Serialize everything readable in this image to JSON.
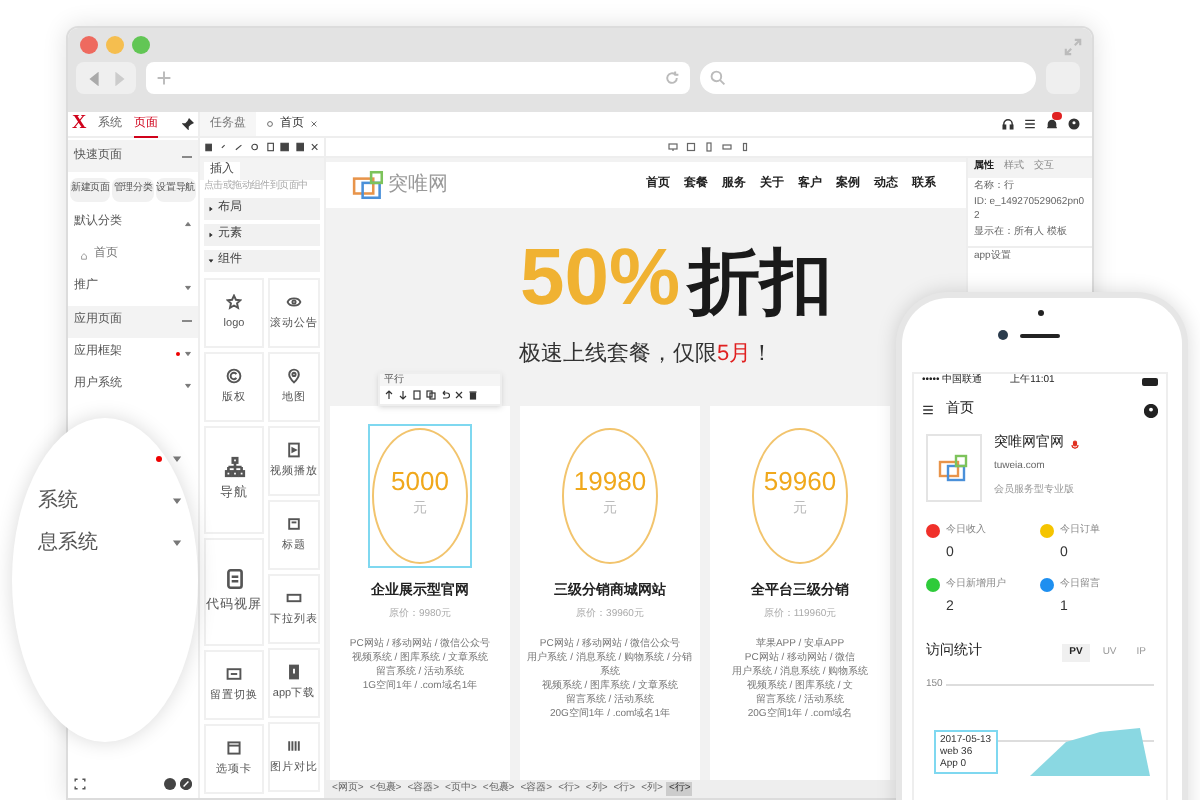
{
  "app_bar": {
    "logo": "X",
    "sidebar_tabs": [
      {
        "label": "系统",
        "selected": false
      },
      {
        "label": "页面",
        "selected": true
      }
    ],
    "doc_tabs": [
      {
        "label": "任务盘",
        "selected": false
      },
      {
        "label": "首页",
        "selected": true
      }
    ]
  },
  "sidebar": [
    {
      "kind": "section",
      "label": "快速页面"
    },
    {
      "kind": "buttons",
      "labels": [
        "新建页面",
        "管理分类",
        "设置导航"
      ]
    },
    {
      "kind": "group",
      "label": "默认分类",
      "expanded": true,
      "dot": false
    },
    {
      "kind": "page",
      "label": "首页"
    },
    {
      "kind": "group",
      "label": "推广",
      "expanded": false,
      "dot": false
    },
    {
      "kind": "section",
      "label": "应用页面"
    },
    {
      "kind": "group",
      "label": "应用框架",
      "expanded": false,
      "dot": true
    },
    {
      "kind": "group",
      "label": "用户系统",
      "expanded": false,
      "dot": false
    }
  ],
  "magnifier": {
    "items": [
      {
        "kind": "dot"
      },
      {
        "kind": "group",
        "label": "系统"
      },
      {
        "kind": "group",
        "label": "息系统"
      }
    ]
  },
  "components_panel": {
    "tab": "插入",
    "hint": "点击或拖动组件到页面中",
    "sections": [
      {
        "label": "布局",
        "expanded": false
      },
      {
        "label": "元素",
        "expanded": false
      },
      {
        "label": "组件",
        "expanded": true
      }
    ],
    "left": [
      {
        "kind": "small",
        "label": "logo"
      },
      {
        "kind": "small",
        "label": "版权"
      },
      {
        "kind": "large",
        "label": "导航"
      },
      {
        "kind": "large",
        "label": "代码视屏"
      },
      {
        "kind": "small",
        "label": "留置切换"
      },
      {
        "kind": "small",
        "label": "选项卡"
      }
    ],
    "right": [
      {
        "label": "滚动公告"
      },
      {
        "label": "地图"
      },
      {
        "label": "视频播放"
      },
      {
        "label": "标题"
      },
      {
        "label": "下拉列表"
      },
      {
        "label": "app下载"
      },
      {
        "label": "图片对比"
      }
    ]
  },
  "site_header": {
    "logo": "突唯网",
    "nav": [
      "首页",
      "套餐",
      "服务",
      "关于",
      "客户",
      "案例",
      "动态",
      "联系"
    ]
  },
  "hero": {
    "highlight": "50%",
    "title": "折扣",
    "subtitle_before": "极速上线套餐，仅限",
    "subtitle_accent": "5月",
    "subtitle_after": "！"
  },
  "selection_toolbar": {
    "label": "平行"
  },
  "plans": [
    {
      "price": "5000",
      "unit": "元",
      "name": "企业展示型官网",
      "original": "原价：9980元",
      "selected": true,
      "features": [
        "PC网站 / 移动网站 / 微信公众号",
        "视频系统 / 图库系统 / 文章系统",
        "留言系统 / 活动系统",
        "1G空间1年 / .com域名1年"
      ]
    },
    {
      "price": "19980",
      "unit": "元",
      "name": "三级分销商城网站",
      "original": "原价：39960元",
      "selected": false,
      "features": [
        "PC网站 / 移动网站 / 微信公众号",
        "用户系统 / 消息系统 / 购物系统 / 分销系统",
        "视频系统 / 图库系统 / 文章系统",
        "留言系统 / 活动系统",
        "20G空间1年 / .com域名1年"
      ]
    },
    {
      "price": "59960",
      "unit": "元",
      "name": "全平台三级分销",
      "original": "原价：119960元",
      "selected": false,
      "features": [
        "苹果APP / 安卓APP",
        "PC网站 / 移动网站 / 微信",
        "用户系统 / 消息系统 / 购物系统",
        "视频系统 / 图库系统 / 文",
        "留言系统 / 活动系统",
        "20G空间1年 / .com域名"
      ]
    }
  ],
  "breadcrumb": [
    {
      "label": "<网页>",
      "selected": false
    },
    {
      "label": "<包裹>",
      "selected": false
    },
    {
      "label": "<容器>",
      "selected": false
    },
    {
      "label": "<页中>",
      "selected": false
    },
    {
      "label": "<包裹>",
      "selected": false
    },
    {
      "label": "<容器>",
      "selected": false
    },
    {
      "label": "<行>",
      "selected": false
    },
    {
      "label": "<列>",
      "selected": false
    },
    {
      "label": "<行>",
      "selected": false
    },
    {
      "label": "<列>",
      "selected": false
    },
    {
      "label": "<行>",
      "selected": true
    }
  ],
  "properties_panel": {
    "tabs": [
      {
        "label": "属性",
        "selected": true
      },
      {
        "label": "样式",
        "selected": false
      },
      {
        "label": "交互",
        "selected": false
      }
    ],
    "fields": [
      "名称：行",
      "ID: e_149270529062pn02",
      "显示在：所有人 模板"
    ],
    "section": "app设置"
  },
  "phone": {
    "carrier": "••••• 中国联通",
    "time": "上午11:01",
    "title": "首页",
    "profile": {
      "name": "突唯网官网",
      "domain": "tuweia.com",
      "plan": "会员服务型专业版"
    },
    "stats": [
      {
        "label": "今日收入",
        "value": "0",
        "color": "#f0302a"
      },
      {
        "label": "今日订单",
        "value": "0",
        "color": "#f5c400"
      },
      {
        "label": "今日新增用户",
        "value": "2",
        "color": "#2ecb3a"
      },
      {
        "label": "今日留言",
        "value": "1",
        "color": "#1e8ff0"
      }
    ],
    "visits": {
      "title": "访问统计",
      "tabs": [
        {
          "label": "PV",
          "selected": true
        },
        {
          "label": "UV",
          "selected": false
        },
        {
          "label": "IP",
          "selected": false
        }
      ],
      "tick": "150",
      "tooltip": [
        "2017-05-13",
        "web 36",
        "App 0"
      ]
    }
  }
}
